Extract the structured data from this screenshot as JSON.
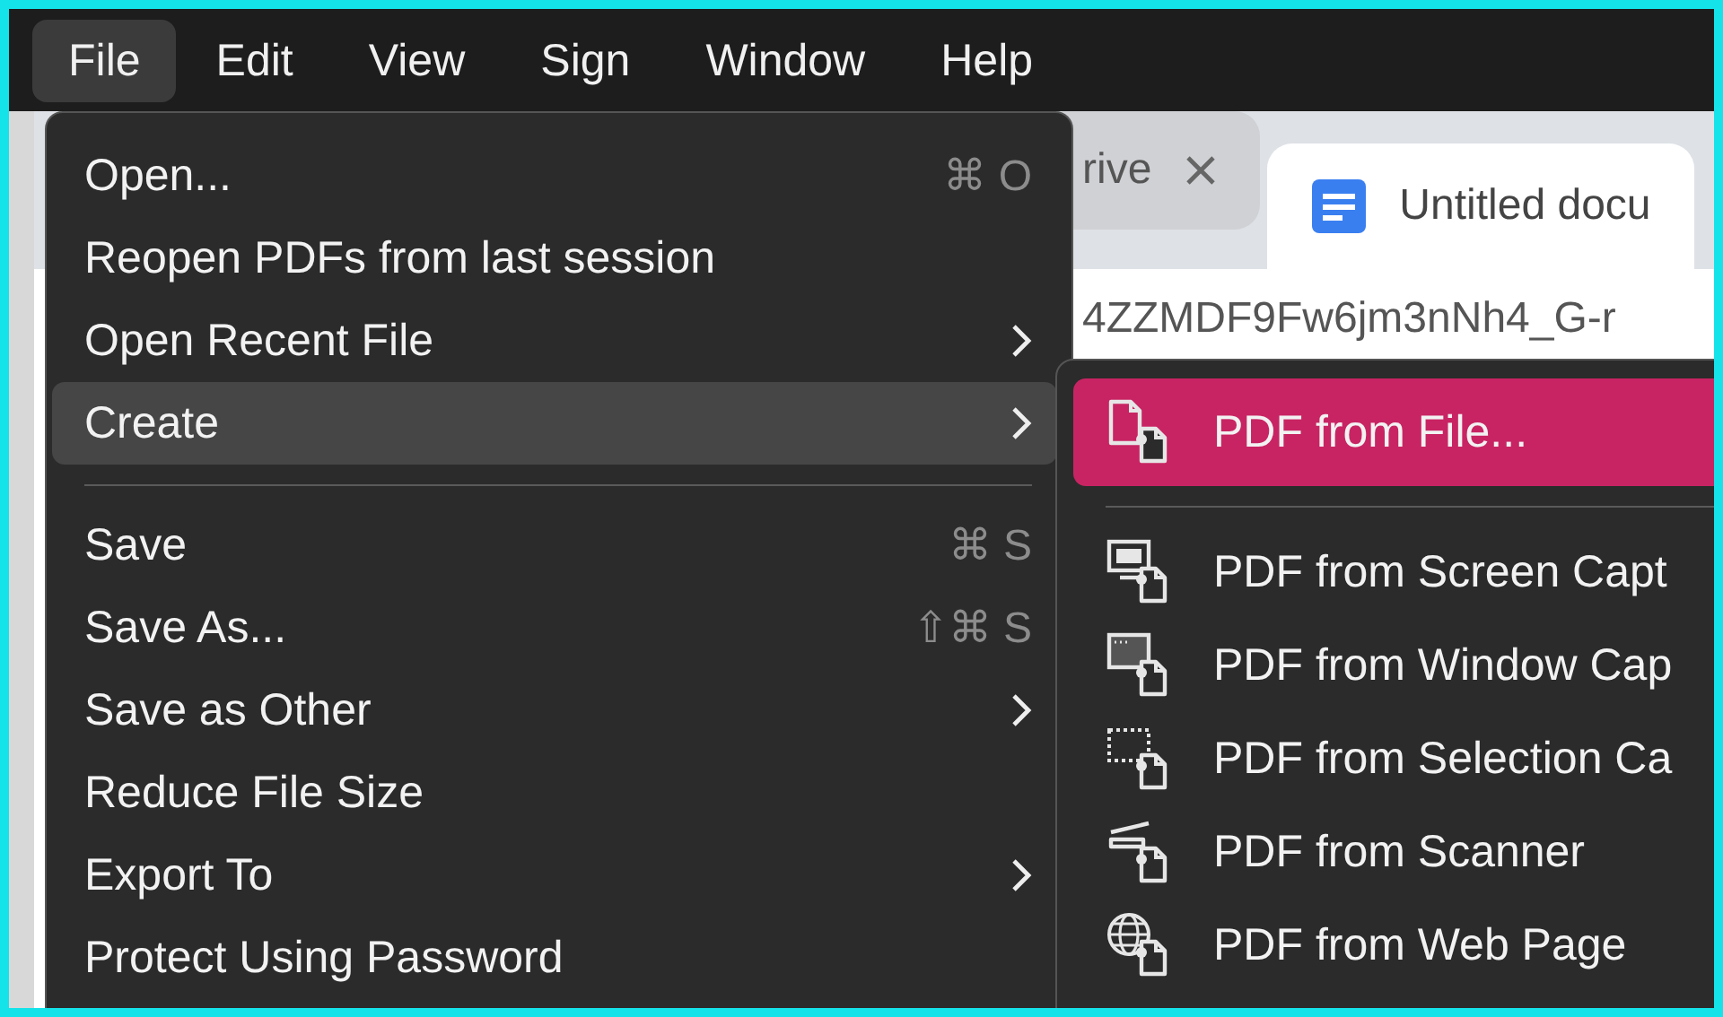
{
  "menu_bar": [
    {
      "label": "File",
      "selected": true
    },
    {
      "label": "Edit",
      "selected": false
    },
    {
      "label": "View",
      "selected": false
    },
    {
      "label": "Sign",
      "selected": false
    },
    {
      "label": "Window",
      "selected": false
    },
    {
      "label": "Help",
      "selected": false
    }
  ],
  "browser": {
    "tabs": [
      {
        "label": "rive",
        "selected": false
      },
      {
        "label": "Untitled docu",
        "selected": true
      }
    ],
    "address": "4ZZMDF9Fw6jm3nNh4_G-r"
  },
  "file_menu": {
    "items": [
      {
        "kind": "item",
        "label": "Open...",
        "shortcut": "⌘ O",
        "submenu": false,
        "selected": false
      },
      {
        "kind": "item",
        "label": "Reopen PDFs from last session",
        "submenu": false,
        "selected": false
      },
      {
        "kind": "item",
        "label": "Open Recent File",
        "submenu": true,
        "selected": false
      },
      {
        "kind": "item",
        "label": "Create",
        "submenu": true,
        "selected": true
      },
      {
        "kind": "separator"
      },
      {
        "kind": "item",
        "label": "Save",
        "shortcut": "⌘ S",
        "submenu": false,
        "selected": false
      },
      {
        "kind": "item",
        "label": "Save As...",
        "shortcut": "⇧⌘ S",
        "submenu": false,
        "selected": false
      },
      {
        "kind": "item",
        "label": "Save as Other",
        "submenu": true,
        "selected": false
      },
      {
        "kind": "item",
        "label": "Reduce File Size",
        "submenu": false,
        "selected": false
      },
      {
        "kind": "item",
        "label": "Export To",
        "submenu": true,
        "selected": false
      },
      {
        "kind": "item",
        "label": "Protect Using Password",
        "submenu": false,
        "selected": false
      }
    ]
  },
  "create_submenu": {
    "items": [
      {
        "kind": "file",
        "label": "PDF from File...",
        "selected": true
      },
      {
        "kind": "separator"
      },
      {
        "kind": "screen",
        "label": "PDF from Screen Capt",
        "selected": false
      },
      {
        "kind": "window",
        "label": "PDF from Window Cap",
        "selected": false
      },
      {
        "kind": "selection",
        "label": "PDF from Selection Ca",
        "selected": false
      },
      {
        "kind": "scanner",
        "label": "PDF from Scanner",
        "selected": false
      },
      {
        "kind": "web",
        "label": "PDF from Web Page",
        "selected": false
      }
    ]
  }
}
